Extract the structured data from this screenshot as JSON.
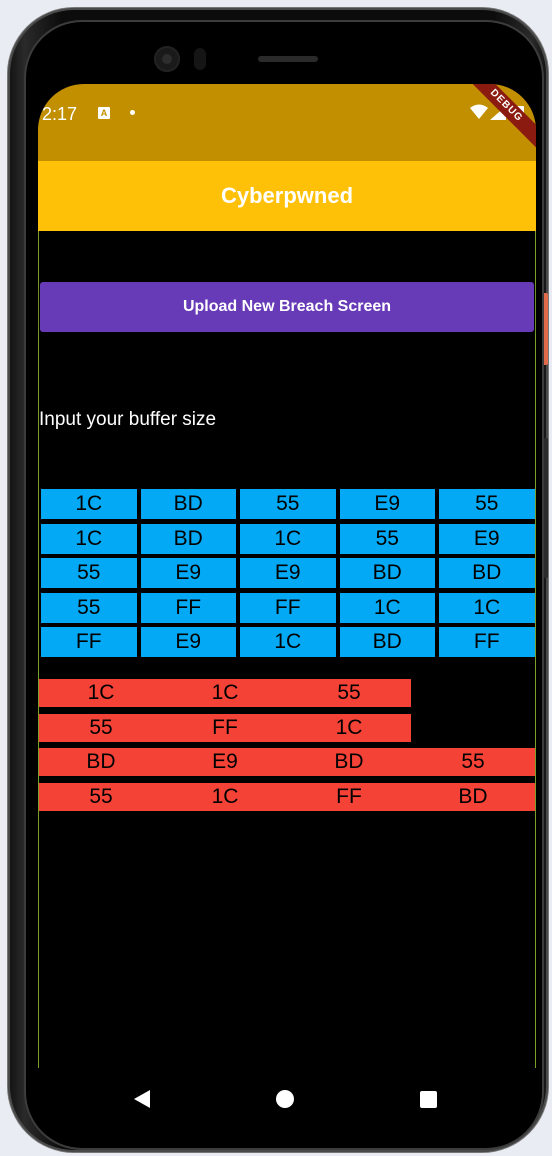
{
  "status_bar": {
    "time": "2:17",
    "notification_letter": "A",
    "debug_label": "DEBUG"
  },
  "app_bar": {
    "title": "Cyberpwned"
  },
  "upload_button": {
    "label": "Upload New Breach Screen"
  },
  "buffer_label": "Input your buffer size",
  "matrix": [
    [
      "1C",
      "BD",
      "55",
      "E9",
      "55"
    ],
    [
      "1C",
      "BD",
      "1C",
      "55",
      "E9"
    ],
    [
      "55",
      "E9",
      "E9",
      "BD",
      "BD"
    ],
    [
      "55",
      "FF",
      "FF",
      "1C",
      "1C"
    ],
    [
      "FF",
      "E9",
      "1C",
      "BD",
      "FF"
    ]
  ],
  "sequences": [
    [
      "1C",
      "1C",
      "55"
    ],
    [
      "55",
      "FF",
      "1C"
    ],
    [
      "BD",
      "E9",
      "BD",
      "55"
    ],
    [
      "55",
      "1C",
      "FF",
      "BD"
    ]
  ],
  "colors": {
    "status_bar": "#c18f00",
    "app_bar": "#ffc107",
    "button": "#673ab7",
    "matrix_cell": "#03a9f4",
    "sequence_row": "#f44336"
  },
  "nav": {
    "back_icon": "back-icon",
    "home_icon": "home-icon",
    "recents_icon": "recents-icon"
  }
}
